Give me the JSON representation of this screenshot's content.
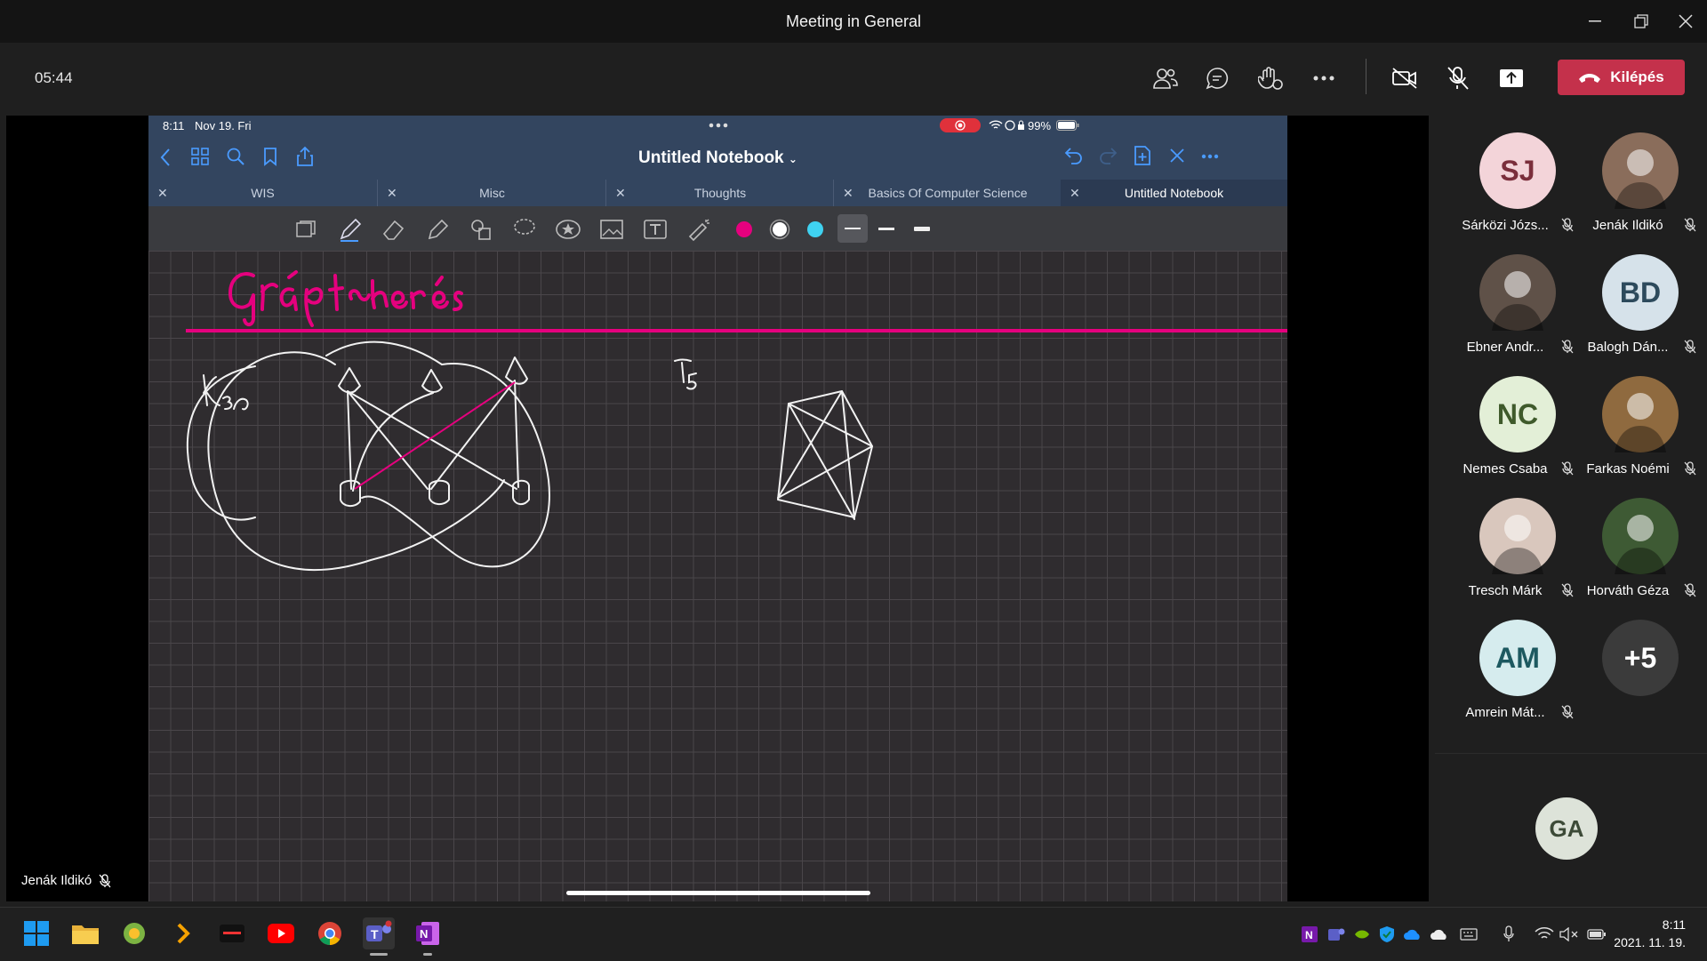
{
  "window": {
    "title": "Meeting in General"
  },
  "meeting": {
    "timer": "05:44",
    "leave_label": "Kilépés"
  },
  "ipad": {
    "status_time": "8:11",
    "status_date": "Nov 19. Fri",
    "battery": "99%",
    "notebook_title": "Untitled Notebook",
    "tabs": [
      {
        "label": "WIS"
      },
      {
        "label": "Misc"
      },
      {
        "label": "Thoughts"
      },
      {
        "label": "Basics Of Computer Science"
      },
      {
        "label": "Untitled Notebook"
      }
    ],
    "pen_colors": [
      "#e5007e",
      "#ffffff",
      "#3fd2f1"
    ]
  },
  "presenter": {
    "name": "Jenák Ildikó"
  },
  "participants": [
    {
      "initials": "SJ",
      "name": "Sárközi Józs...",
      "bg": "#f3d4d9",
      "fg": "#7a2e3b"
    },
    {
      "initials": "",
      "name": "Jenák Ildikó",
      "bg": "#8a6d5b",
      "fg": "#ffffff"
    },
    {
      "initials": "",
      "name": "Ebner Andr...",
      "bg": "#5f5148",
      "fg": "#ffffff"
    },
    {
      "initials": "BD",
      "name": "Balogh Dán...",
      "bg": "#d6e2ea",
      "fg": "#2d4a5c"
    },
    {
      "initials": "NC",
      "name": "Nemes Csaba",
      "bg": "#e3efd7",
      "fg": "#3f5a2b"
    },
    {
      "initials": "",
      "name": "Farkas Noémi",
      "bg": "#8f6a3f",
      "fg": "#ffffff"
    },
    {
      "initials": "",
      "name": "Tresch Márk",
      "bg": "#d9c7bd",
      "fg": "#ffffff"
    },
    {
      "initials": "",
      "name": "Horváth Géza",
      "bg": "#3e5a34",
      "fg": "#ffffff"
    },
    {
      "initials": "AM",
      "name": "Amrein Mát...",
      "bg": "#d6ecee",
      "fg": "#1d5960"
    },
    {
      "initials": "+5",
      "name": "",
      "bg": "#3b3b3b",
      "fg": "#ffffff"
    }
  ],
  "self_avatar": {
    "initials": "GA",
    "bg": "#dde3d9",
    "fg": "#3c4a37"
  },
  "taskbar": {
    "time": "8:11",
    "date": "2021. 11. 19."
  }
}
